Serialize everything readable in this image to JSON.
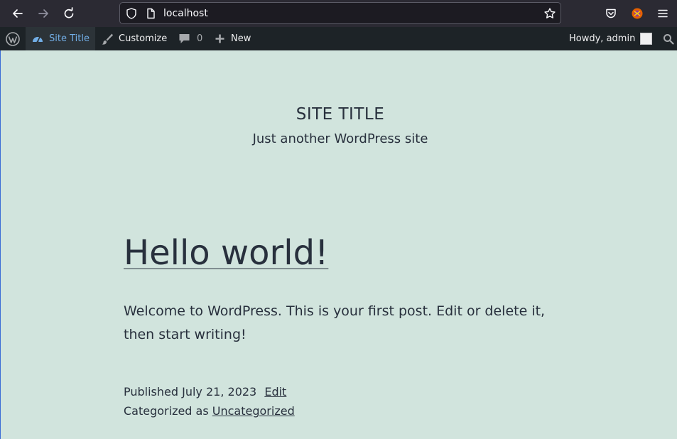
{
  "browser": {
    "url": "localhost"
  },
  "admin_bar": {
    "site_title": "Site Title",
    "customize": "Customize",
    "comments_count": "0",
    "new": "New",
    "howdy": "Howdy, admin"
  },
  "site": {
    "title": "SITE TITLE",
    "tagline": "Just another WordPress site"
  },
  "post": {
    "title": "Hello world!",
    "body": "Welcome to WordPress. This is your first post. Edit or delete it, then start writing!",
    "published_prefix": "Published",
    "date": "July 21, 2023",
    "edit_link": "Edit",
    "categorized_prefix": "Categorized as",
    "category": "Uncategorized"
  },
  "colors": {
    "page_background": "#d1e4dd",
    "admin_bar": "#1d2327",
    "browser_chrome": "#2b2a33",
    "accent": "#72aee6",
    "text": "#28303d"
  }
}
